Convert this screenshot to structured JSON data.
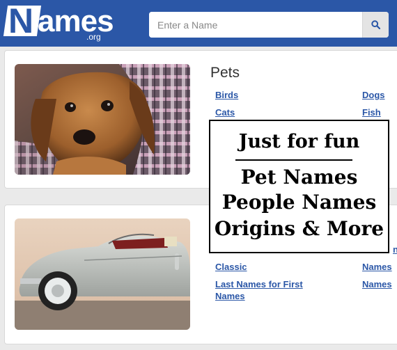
{
  "header": {
    "logo_initial": "N",
    "logo_rest": "ames",
    "logo_suffix": ".org",
    "search_placeholder": "Enter a Name",
    "search_icon": "magnifier-icon",
    "brand_color": "#2b57a7"
  },
  "cards": [
    {
      "title": "Pets",
      "image": "puppy-photo",
      "links": [
        "Birds",
        "Dogs",
        "Cats",
        "Fish"
      ]
    },
    {
      "title": "",
      "image": "classic-convertible-car-photo",
      "links": [
        "Classic",
        "Names",
        "Last Names for First",
        "Names",
        "Names"
      ]
    }
  ],
  "overlay": {
    "heading": "Just for fun",
    "lines": [
      "Pet Names",
      "People Names",
      "Origins & More"
    ]
  }
}
